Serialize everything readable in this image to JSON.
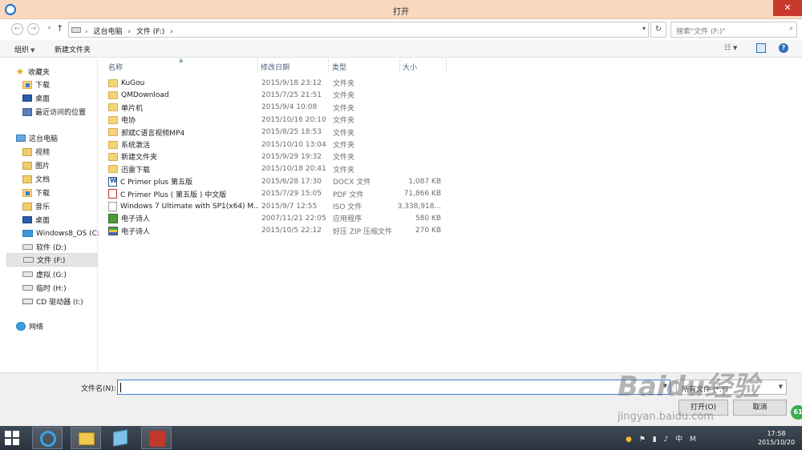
{
  "window": {
    "title": "打开",
    "close_glyph": "✕"
  },
  "address": {
    "crumbs": [
      "这台电脑",
      "›",
      "文件 (F:)",
      "›"
    ],
    "search_placeholder": "搜索\"文件 (F:)\""
  },
  "toolbar": {
    "organize": "组织",
    "new_folder": "新建文件夹"
  },
  "sidebar": {
    "favorites": "收藏夹",
    "fav_items": [
      "下载",
      "桌面",
      "最近访问的位置"
    ],
    "thispc": "这台电脑",
    "pc_items": [
      "视频",
      "图片",
      "文档",
      "下载",
      "音乐",
      "桌面",
      "Windows8_OS (C:)",
      "软件 (D:)",
      "文件 (F:)",
      "虚拟 (G:)",
      "临时 (H:)",
      "CD 驱动器 (I:)"
    ],
    "network": "网络"
  },
  "columns": {
    "name": "名称",
    "date": "修改日期",
    "type": "类型",
    "size": "大小"
  },
  "files": [
    {
      "name": "KuGou",
      "date": "2015/9/18 23:12",
      "type": "文件夹",
      "size": "",
      "icon": "folder-icon"
    },
    {
      "name": "QMDownload",
      "date": "2015/7/25 21:51",
      "type": "文件夹",
      "size": "",
      "icon": "folder-icon"
    },
    {
      "name": "单片机",
      "date": "2015/9/4 10:08",
      "type": "文件夹",
      "size": "",
      "icon": "folder-icon"
    },
    {
      "name": "电协",
      "date": "2015/10/16 20:10",
      "type": "文件夹",
      "size": "",
      "icon": "folder-icon"
    },
    {
      "name": "郝斌C语言视频MP4",
      "date": "2015/8/25 18:53",
      "type": "文件夹",
      "size": "",
      "icon": "folder-icon"
    },
    {
      "name": "系统激活",
      "date": "2015/10/10 13:04",
      "type": "文件夹",
      "size": "",
      "icon": "folder-icon"
    },
    {
      "name": "新建文件夹",
      "date": "2015/9/29 19:32",
      "type": "文件夹",
      "size": "",
      "icon": "folder-icon"
    },
    {
      "name": "迅雷下载",
      "date": "2015/10/18 20:41",
      "type": "文件夹",
      "size": "",
      "icon": "folder-icon"
    },
    {
      "name": "C Primer plus 第五版",
      "date": "2015/6/28 17:30",
      "type": "DOCX 文件",
      "size": "1,087 KB",
      "icon": "docx-icon"
    },
    {
      "name": "C Primer Plus ( 第五版 ) 中文版",
      "date": "2015/7/29 15:05",
      "type": "PDF 文件",
      "size": "71,866 KB",
      "icon": "pdf-icon"
    },
    {
      "name": "Windows 7 Ultimate with SP1(x64) M...",
      "date": "2015/9/7 12:55",
      "type": "ISO 文件",
      "size": "3,338,918...",
      "icon": "iso-icon"
    },
    {
      "name": "电子诗人",
      "date": "2007/11/21 22:05",
      "type": "应用程序",
      "size": "580 KB",
      "icon": "exe-icon"
    },
    {
      "name": "电子诗人",
      "date": "2015/10/5 22:12",
      "type": "好压 ZIP 压缩文件",
      "size": "270 KB",
      "icon": "zip-icon"
    }
  ],
  "bottom": {
    "filename_label": "文件名(N):",
    "filename_value": "",
    "filetype_value": "所有文件 (*.*)",
    "open_label": "打开(O)",
    "cancel_label": "取消",
    "badge": "61"
  },
  "taskbar": {
    "tray_items": [
      "中",
      "M"
    ],
    "time": "17:58",
    "date": "2015/10/20"
  },
  "watermark": {
    "main": "Baidu经验",
    "sub": "jingyan.baidu.com"
  }
}
